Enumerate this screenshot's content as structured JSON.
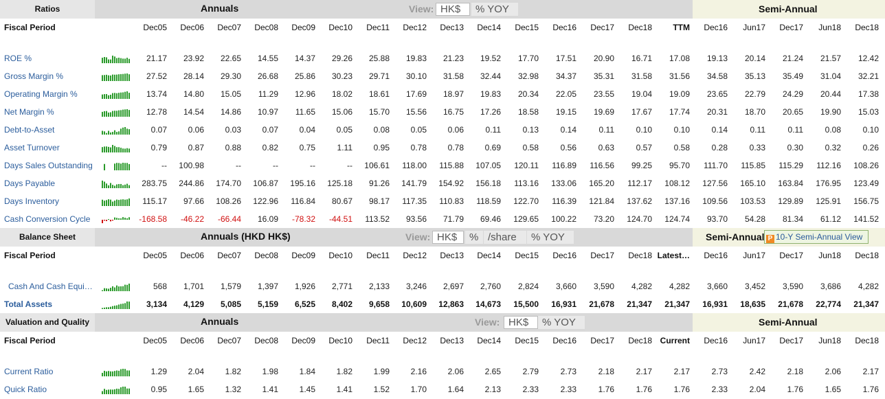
{
  "colors": {
    "link": "#2b5d9c",
    "negative": "#d01010",
    "spark": "#2a9a2a",
    "spark_neg": "#d01010"
  },
  "sections": [
    {
      "key": "ratios",
      "header": {
        "left": "Ratios",
        "annual_title": "Annuals",
        "view_label": "View:",
        "view_options": [
          "HK$",
          "% YOY"
        ],
        "view_selected": 0,
        "semi_title": "Semi-Annual",
        "ten_year_button": ""
      },
      "period_label": "Fiscal Period",
      "annual_periods": [
        "Dec05",
        "Dec06",
        "Dec07",
        "Dec08",
        "Dec09",
        "Dec10",
        "Dec11",
        "Dec12",
        "Dec13",
        "Dec14",
        "Dec15",
        "Dec16",
        "Dec17",
        "Dec18",
        "TTM"
      ],
      "semi_periods": [
        "Dec16",
        "Jun17",
        "Dec17",
        "Jun18",
        "Dec18"
      ],
      "rows": [
        {
          "label": "ROE %",
          "annual": [
            "21.17",
            "23.92",
            "22.65",
            "14.55",
            "14.37",
            "29.26",
            "25.88",
            "19.83",
            "21.23",
            "19.52",
            "17.70",
            "17.51",
            "20.90",
            "16.71",
            "17.08"
          ],
          "semi": [
            "19.13",
            "20.14",
            "21.24",
            "21.57",
            "12.42"
          ]
        },
        {
          "label": "Gross Margin %",
          "annual": [
            "27.52",
            "28.14",
            "29.30",
            "26.68",
            "25.86",
            "30.23",
            "29.71",
            "30.10",
            "31.58",
            "32.44",
            "32.98",
            "34.37",
            "35.31",
            "31.58",
            "31.56"
          ],
          "semi": [
            "34.58",
            "35.13",
            "35.49",
            "31.04",
            "32.21"
          ]
        },
        {
          "label": "Operating Margin %",
          "annual": [
            "13.74",
            "14.80",
            "15.05",
            "11.29",
            "12.96",
            "18.02",
            "18.61",
            "17.69",
            "18.97",
            "19.83",
            "20.34",
            "22.05",
            "23.55",
            "19.04",
            "19.09"
          ],
          "semi": [
            "23.65",
            "22.79",
            "24.29",
            "20.44",
            "17.38"
          ]
        },
        {
          "label": "Net Margin %",
          "annual": [
            "12.78",
            "14.54",
            "14.86",
            "10.97",
            "11.65",
            "15.06",
            "15.70",
            "15.56",
            "16.75",
            "17.26",
            "18.58",
            "19.15",
            "19.69",
            "17.67",
            "17.74"
          ],
          "semi": [
            "20.31",
            "18.70",
            "20.65",
            "19.90",
            "15.03"
          ]
        },
        {
          "label": "Debt-to-Asset",
          "annual": [
            "0.07",
            "0.06",
            "0.03",
            "0.07",
            "0.04",
            "0.05",
            "0.08",
            "0.05",
            "0.06",
            "0.11",
            "0.13",
            "0.14",
            "0.11",
            "0.10",
            "0.10"
          ],
          "semi": [
            "0.14",
            "0.11",
            "0.11",
            "0.08",
            "0.10"
          ]
        },
        {
          "label": "Asset Turnover",
          "annual": [
            "0.79",
            "0.87",
            "0.88",
            "0.82",
            "0.75",
            "1.11",
            "0.95",
            "0.78",
            "0.78",
            "0.69",
            "0.58",
            "0.56",
            "0.63",
            "0.57",
            "0.58"
          ],
          "semi": [
            "0.28",
            "0.33",
            "0.30",
            "0.32",
            "0.26"
          ]
        },
        {
          "label": "Days Sales Outstanding",
          "annual": [
            "--",
            "100.98",
            "--",
            "--",
            "--",
            "--",
            "106.61",
            "118.00",
            "115.88",
            "107.05",
            "120.11",
            "116.89",
            "116.56",
            "99.25",
            "95.70"
          ],
          "semi": [
            "111.70",
            "115.85",
            "115.29",
            "112.16",
            "108.26"
          ]
        },
        {
          "label": "Days Payable",
          "annual": [
            "283.75",
            "244.86",
            "174.70",
            "106.87",
            "195.16",
            "125.18",
            "91.26",
            "141.79",
            "154.92",
            "156.18",
            "113.16",
            "133.06",
            "165.20",
            "112.17",
            "108.12"
          ],
          "semi": [
            "127.56",
            "165.10",
            "163.84",
            "176.95",
            "123.49"
          ]
        },
        {
          "label": "Days Inventory",
          "annual": [
            "115.17",
            "97.66",
            "108.26",
            "122.96",
            "116.84",
            "80.67",
            "98.17",
            "117.35",
            "110.83",
            "118.59",
            "122.70",
            "116.39",
            "121.84",
            "137.62",
            "137.16"
          ],
          "semi": [
            "109.56",
            "103.53",
            "129.89",
            "125.91",
            "156.75"
          ]
        },
        {
          "label": "Cash Conversion Cycle",
          "annual": [
            "-168.58",
            "-46.22",
            "-66.44",
            "16.09",
            "-78.32",
            "-44.51",
            "113.52",
            "93.56",
            "71.79",
            "69.46",
            "129.65",
            "100.22",
            "73.20",
            "124.70",
            "124.74"
          ],
          "semi": [
            "93.70",
            "54.28",
            "81.34",
            "61.12",
            "141.52"
          ]
        }
      ]
    },
    {
      "key": "balance",
      "header": {
        "left": "Balance Sheet",
        "annual_title": "Annuals (HKD HK$)",
        "view_label": "View:",
        "view_options": [
          "HK$",
          "%",
          "/share",
          "% YOY"
        ],
        "view_selected": 0,
        "semi_title": "Semi-Annual",
        "ten_year_button": "10-Y Semi-Annual View"
      },
      "period_label": "Fiscal Period",
      "annual_periods": [
        "Dec05",
        "Dec06",
        "Dec07",
        "Dec08",
        "Dec09",
        "Dec10",
        "Dec11",
        "Dec12",
        "Dec13",
        "Dec14",
        "Dec15",
        "Dec16",
        "Dec17",
        "Dec18",
        "Latest…"
      ],
      "semi_periods": [
        "Dec16",
        "Jun17",
        "Dec17",
        "Jun18",
        "Dec18"
      ],
      "rows": [
        {
          "label": "Cash And Cash Equi…",
          "annual": [
            "568",
            "1,701",
            "1,579",
            "1,397",
            "1,926",
            "2,771",
            "2,133",
            "3,246",
            "2,697",
            "2,760",
            "2,824",
            "3,660",
            "3,590",
            "4,282",
            "4,282"
          ],
          "semi": [
            "3,660",
            "3,452",
            "3,590",
            "3,686",
            "4,282"
          ]
        },
        {
          "label": "Total Assets",
          "bold": true,
          "annual": [
            "3,134",
            "4,129",
            "5,085",
            "5,159",
            "6,525",
            "8,402",
            "9,658",
            "10,609",
            "12,863",
            "14,673",
            "15,500",
            "16,931",
            "21,678",
            "21,347",
            "21,347"
          ],
          "semi": [
            "16,931",
            "18,635",
            "21,678",
            "22,774",
            "21,347"
          ]
        }
      ]
    },
    {
      "key": "valuation",
      "header": {
        "left": "Valuation and Quality",
        "annual_title": "Annuals",
        "view_label": "View:",
        "view_options": [
          "HK$",
          "% YOY"
        ],
        "view_selected": 0,
        "semi_title": "Semi-Annual",
        "ten_year_button": ""
      },
      "period_label": "Fiscal Period",
      "annual_periods": [
        "Dec05",
        "Dec06",
        "Dec07",
        "Dec08",
        "Dec09",
        "Dec10",
        "Dec11",
        "Dec12",
        "Dec13",
        "Dec14",
        "Dec15",
        "Dec16",
        "Dec17",
        "Dec18",
        "Current"
      ],
      "semi_periods": [
        "Dec16",
        "Jun17",
        "Dec17",
        "Jun18",
        "Dec18"
      ],
      "rows": [
        {
          "label": "Current Ratio",
          "annual": [
            "1.29",
            "2.04",
            "1.82",
            "1.98",
            "1.84",
            "1.82",
            "1.99",
            "2.16",
            "2.06",
            "2.65",
            "2.79",
            "2.73",
            "2.18",
            "2.17",
            "2.17"
          ],
          "semi": [
            "2.73",
            "2.42",
            "2.18",
            "2.06",
            "2.17"
          ]
        },
        {
          "label": "Quick Ratio",
          "annual": [
            "0.95",
            "1.65",
            "1.32",
            "1.41",
            "1.45",
            "1.41",
            "1.52",
            "1.70",
            "1.64",
            "2.13",
            "2.33",
            "2.33",
            "1.76",
            "1.76",
            "1.76"
          ],
          "semi": [
            "2.33",
            "2.04",
            "1.76",
            "1.65",
            "1.76"
          ]
        }
      ]
    }
  ]
}
